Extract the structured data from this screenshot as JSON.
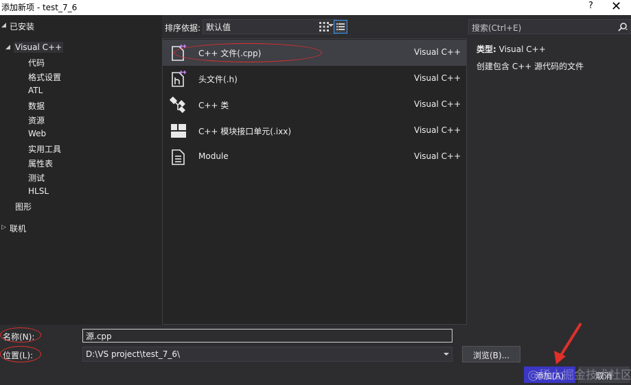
{
  "window": {
    "title": "添加新项 - test_7_6",
    "help": "?",
    "close": "✕"
  },
  "tree": {
    "installed": "已安装",
    "visual_cpp": "Visual C++",
    "children": [
      "代码",
      "格式设置",
      "ATL",
      "数据",
      "资源",
      "Web",
      "实用工具",
      "属性表",
      "测试",
      "HLSL"
    ],
    "graphics": "图形",
    "online": "联机"
  },
  "toolbar": {
    "sort_label": "排序依据:",
    "sort_value": "默认值"
  },
  "templates": [
    {
      "name": "C++ 文件(.cpp)",
      "lang": "Visual C++",
      "icon": "cpp-file-icon"
    },
    {
      "name": "头文件(.h)",
      "lang": "Visual C++",
      "icon": "header-file-icon"
    },
    {
      "name": "C++ 类",
      "lang": "Visual C++",
      "icon": "class-icon"
    },
    {
      "name": "C++ 模块接口单元(.ixx)",
      "lang": "Visual C++",
      "icon": "module-unit-icon"
    },
    {
      "name": "Module",
      "lang": "Visual C++",
      "icon": "module-file-icon"
    }
  ],
  "details": {
    "search_placeholder": "搜索(Ctrl+E)",
    "type_key": "类型:",
    "type_value": "Visual C++",
    "description": "创建包含 C++ 源代码的文件"
  },
  "form": {
    "name_label": "名称(N):",
    "name_value": "源.cpp",
    "location_label": "位置(L):",
    "location_value": "D:\\VS project\\test_7_6\\",
    "browse_label": "浏览(B)...",
    "add_label": "添加(A)",
    "cancel_label": "取消"
  },
  "watermark": "@稀土掘金技术社区",
  "colors": {
    "background": "#2d2d30",
    "panel": "#252526",
    "accent": "#3b36c4",
    "annotation": "#e0302a"
  }
}
